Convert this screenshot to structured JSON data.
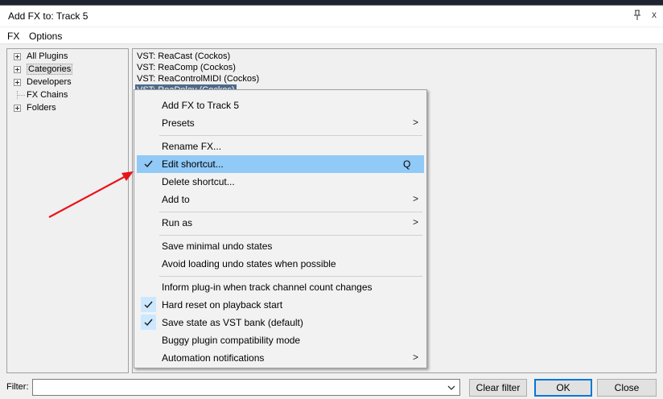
{
  "window": {
    "title": "Add FX to: Track 5",
    "close_glyph": "x"
  },
  "menubar": {
    "items": [
      "FX",
      "Options"
    ]
  },
  "tree": {
    "items": [
      {
        "label": "All Plugins",
        "expandable": true
      },
      {
        "label": "Categories",
        "expandable": true,
        "selected": true
      },
      {
        "label": "Developers",
        "expandable": true
      },
      {
        "label": "FX Chains",
        "expandable": false
      },
      {
        "label": "Folders",
        "expandable": true
      }
    ]
  },
  "plugin_list": {
    "items": [
      {
        "label": "VST: ReaCast (Cockos)"
      },
      {
        "label": "VST: ReaComp (Cockos)"
      },
      {
        "label": "VST: ReaControlMIDI (Cockos)"
      },
      {
        "label": "VST: ReaDelay (Cockos)",
        "selected": true
      }
    ]
  },
  "context_menu": {
    "items": [
      {
        "label": "Add FX to Track 5"
      },
      {
        "label": "Presets",
        "submenu": true
      },
      {
        "label": "Rename FX..."
      },
      {
        "label": "Edit shortcut...",
        "checked": true,
        "shortcut": "Q",
        "highlighted": true
      },
      {
        "label": "Delete shortcut..."
      },
      {
        "label": "Add to",
        "submenu": true
      },
      {
        "label": "Run as",
        "submenu": true
      },
      {
        "label": "Save minimal undo states"
      },
      {
        "label": "Avoid loading undo states when possible"
      },
      {
        "label": "Inform plug-in when track channel count changes"
      },
      {
        "label": "Hard reset on playback start",
        "checked": true
      },
      {
        "label": "Save state as VST bank (default)",
        "checked": true
      },
      {
        "label": "Buggy plugin compatibility mode"
      },
      {
        "label": "Automation notifications",
        "submenu": true
      }
    ],
    "submenu_glyph": ">",
    "check_glyph": "✓"
  },
  "bottom": {
    "filter_label": "Filter:",
    "filter_value": "",
    "clear_filter_label": "Clear filter",
    "ok_label": "OK",
    "cancel_label": "Close"
  },
  "colors": {
    "highlight": "#91c9f7",
    "check_box": "#cce8ff",
    "selected_item": "#4d6a8a",
    "annotation_arrow": "#e8141a",
    "default_button_border": "#0078d7"
  }
}
